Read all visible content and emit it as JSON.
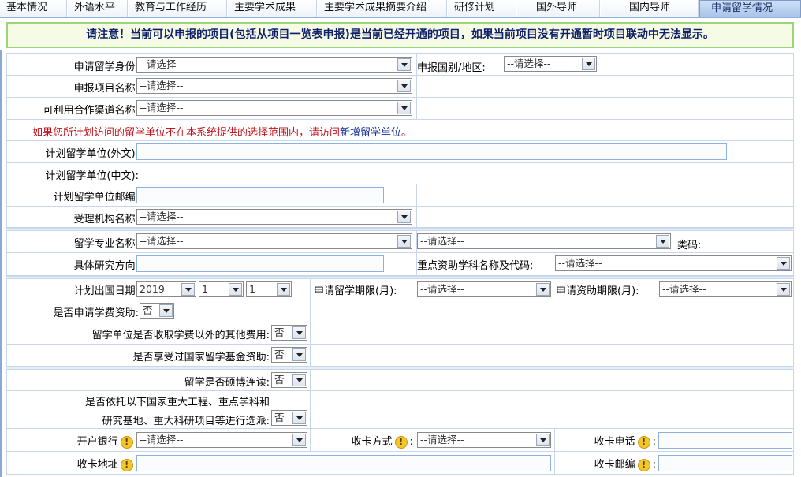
{
  "tabs": [
    {
      "label": "基本情况"
    },
    {
      "label": "外语水平"
    },
    {
      "label": "教育与工作经历"
    },
    {
      "label": "主要学术成果"
    },
    {
      "label": "主要学术成果摘要介绍"
    },
    {
      "label": "研修计划"
    },
    {
      "label": "国外导师"
    },
    {
      "label": "国内导师"
    },
    {
      "label": "申请留学情况"
    }
  ],
  "notice": "请注意！当前可以申报的项目(包括从项目一览表申报)是当前已经开通的项目，如果当前项目没有开通暂时项目联动中无法显示。",
  "form": {
    "identity_label": "申请留学身份:",
    "identity_value": "--请选择--",
    "country_label": "申报国别/地区:",
    "country_value": "--请选择--",
    "project_label": "申报项目名称:",
    "project_value": "--请选择--",
    "channel_label": "可利用合作渠道名称:",
    "channel_value": "--请选择--",
    "hint_prefix": "如果您所计划访问的留学单位不在本系统提供的选择范围内，请访问",
    "hint_link": "新增留学单位",
    "hint_suffix": "。",
    "unit_foreign_label": "计划留学单位(外文):",
    "unit_chinese_label": "计划留学单位(中文):",
    "unit_zip_label": "计划留学单位邮编:",
    "agency_label": "受理机构名称:",
    "agency_value": "--请选择--",
    "major_label": "留学专业名称:",
    "major_value": "--请选择--",
    "major_sub_value": "--请选择--",
    "category_label": "类码:",
    "direction_label": "具体研究方向:",
    "discipline_label": "重点资助学科名称及代码:",
    "discipline_value": "--请选择--",
    "depart_label": "计划出国日期:",
    "depart_year": "2019",
    "depart_month": "1",
    "depart_day": "1",
    "period_label": "申请留学期限(月):",
    "period_value": "--请选择--",
    "fund_period_label": "申请资助期限(月):",
    "fund_period_value": "--请选择--",
    "tuition_label": "是否申请学费资助:",
    "tuition_value": "否",
    "other_fee_label": "留学单位是否收取学费以外的其他费用:",
    "other_fee_value": "否",
    "csc_label": "是否享受过国家留学基金资助:",
    "csc_value": "否",
    "masterphd_label": "留学是否硕博连读:",
    "masterphd_value": "否",
    "major_project_line1": "是否依托以下国家重大工程、重点学科和",
    "major_project_line2": "研究基地、重大科研项目等进行选派:",
    "major_project_value": "否",
    "bank_label": "开户银行",
    "bank_value": "--请选择--",
    "card_type_label": "收卡方式",
    "card_type_value": "--请选择--",
    "card_phone_label": "收卡电话",
    "card_address_label": "收卡地址",
    "card_zip_label": "收卡邮编",
    "warn_glyph": "!",
    "colon": ":"
  },
  "colors": {
    "tab_active": "#a9c5ea",
    "notice_border": "#9bd57a",
    "notice_text": "#0f1f6b",
    "hint_red": "#c4121a",
    "link_blue": "#17309a",
    "row_border": "#c7d6ea"
  }
}
